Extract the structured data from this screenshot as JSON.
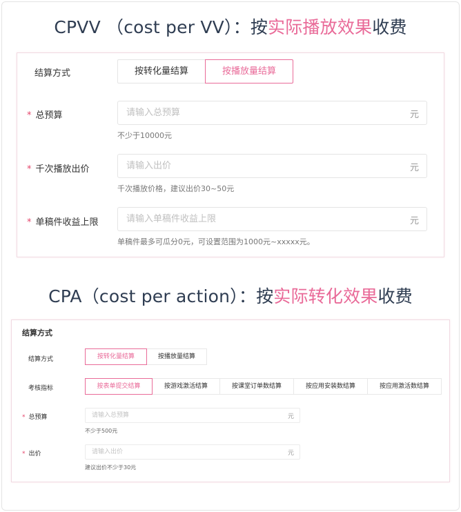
{
  "cpvv": {
    "heading": {
      "prefix": "CPVV （cost per VV）：按",
      "accent": "实际播放效果",
      "suffix": "收费"
    },
    "settlement": {
      "label": "结算方式",
      "options": [
        "按转化量结算",
        "按播放量结算"
      ],
      "selected": "按播放量结算"
    },
    "budget": {
      "label": "总预算",
      "placeholder": "请输入总预算",
      "unit": "元",
      "hint": "不少于10000元"
    },
    "bid": {
      "label": "千次播放出价",
      "placeholder": "请输入出价",
      "unit": "元",
      "hint": "千次播放价格，建议出价30~50元"
    },
    "limit": {
      "label": "单稿件收益上限",
      "placeholder": "请输入单稿件收益上限",
      "unit": "元",
      "hint": "单稿件最多可瓜分0元，可设置范围为1000元~xxxxx元。"
    }
  },
  "cpa": {
    "heading": {
      "prefix": "CPA（cost per action）：按",
      "accent": "实际转化效果",
      "suffix": "收费"
    },
    "section_title": "结算方式",
    "settlement": {
      "label": "结算方式",
      "options": [
        "按转化量结算",
        "按播放量结算"
      ],
      "selected": "按转化量结算"
    },
    "metric": {
      "label": "考核指标",
      "options": [
        "按表单提交结算",
        "按游戏激活结算",
        "按课堂订单数结算",
        "按应用安装数结算",
        "按应用激活数结算"
      ],
      "selected": "按表单提交结算"
    },
    "budget": {
      "label": "总预算",
      "placeholder": "请输入总预算",
      "unit": "元",
      "hint": "不少于500元"
    },
    "bid": {
      "label": "出价",
      "placeholder": "请输入出价",
      "unit": "元",
      "hint": "建议出价不少于30元"
    }
  },
  "required_mark": "*",
  "colors": {
    "accent": "#e96a98",
    "heading": "#2f3d52",
    "required": "#e5466c",
    "border": "#e4e4e4"
  }
}
